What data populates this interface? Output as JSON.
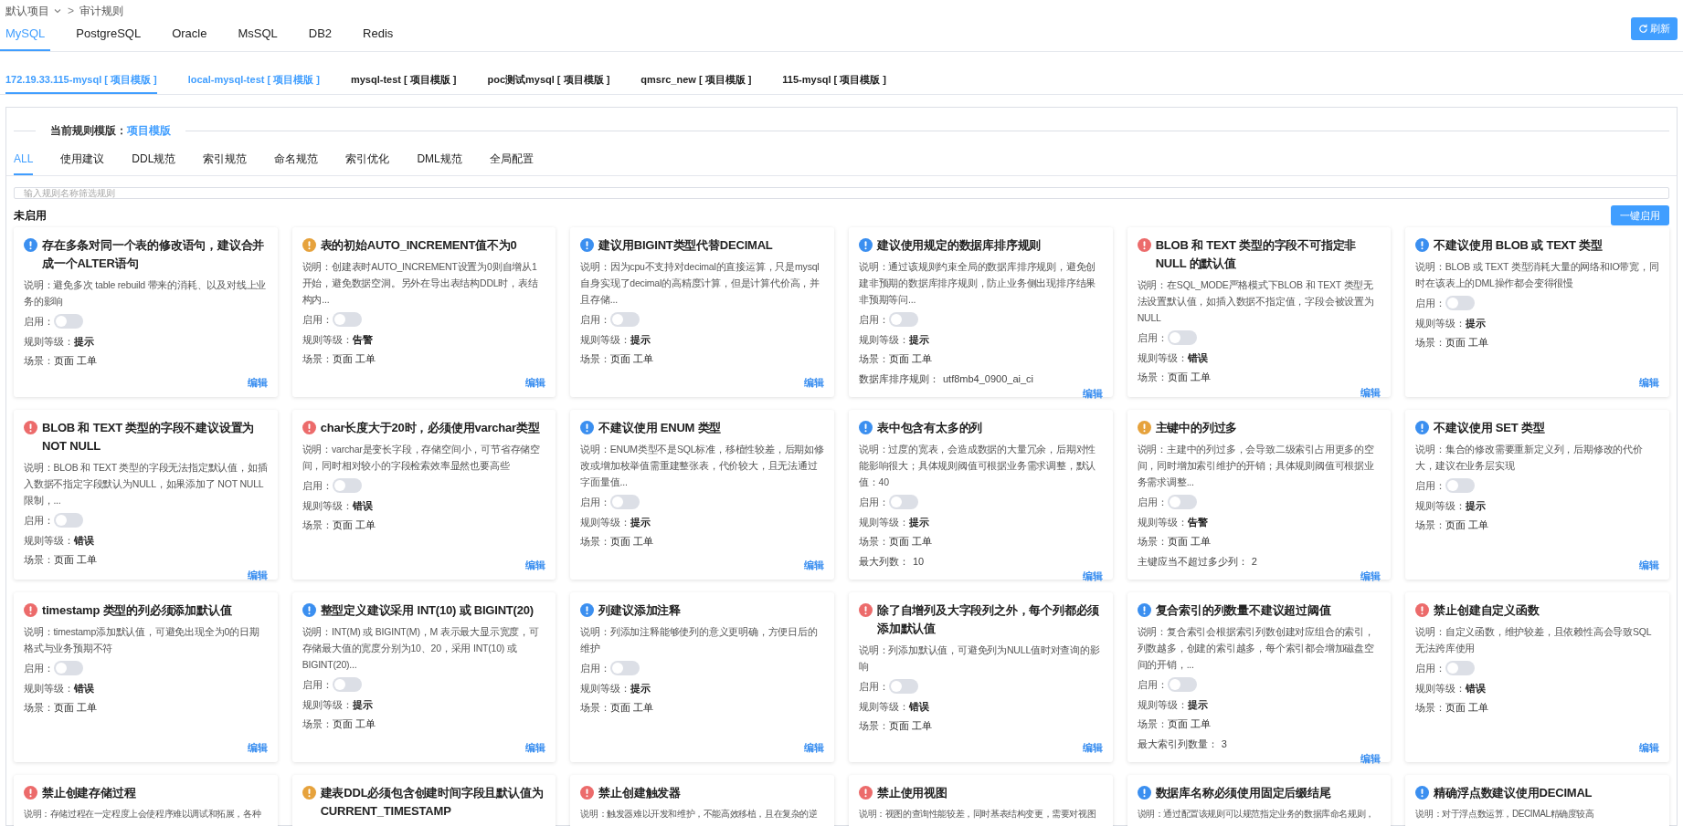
{
  "breadcrumb": {
    "project": "默认项目",
    "separator": ">",
    "page": "审计规则"
  },
  "db_tabs": [
    {
      "label": "MySQL",
      "selected": true
    },
    {
      "label": "PostgreSQL",
      "selected": false
    },
    {
      "label": "Oracle",
      "selected": false
    },
    {
      "label": "MsSQL",
      "selected": false
    },
    {
      "label": "DB2",
      "selected": false
    },
    {
      "label": "Redis",
      "selected": false
    }
  ],
  "refresh_button": "刷新",
  "instance_tabs": [
    {
      "label": "172.19.33.115-mysql [ 项目模版 ]",
      "selected": true,
      "hovered": false
    },
    {
      "label": "local-mysql-test [ 项目模版 ]",
      "selected": false,
      "hovered": true
    },
    {
      "label": "mysql-test [ 项目模版 ]",
      "selected": false,
      "hovered": false
    },
    {
      "label": "poc测试mysql [ 项目模版 ]",
      "selected": false,
      "hovered": false
    },
    {
      "label": "qmsrc_new [ 项目模版 ]",
      "selected": false,
      "hovered": false
    },
    {
      "label": "115-mysql [ 项目模版 ]",
      "selected": false,
      "hovered": false
    }
  ],
  "template": {
    "label": "当前规则模版：",
    "value": "项目模版"
  },
  "category_tabs": [
    {
      "label": "ALL",
      "selected": true
    },
    {
      "label": "使用建议",
      "selected": false
    },
    {
      "label": "DDL规范",
      "selected": false
    },
    {
      "label": "索引规范",
      "selected": false
    },
    {
      "label": "命名规范",
      "selected": false
    },
    {
      "label": "索引优化",
      "selected": false
    },
    {
      "label": "DML规范",
      "selected": false
    },
    {
      "label": "全局配置",
      "selected": false
    }
  ],
  "search": {
    "placeholder": "输入规则名称筛选规则"
  },
  "section": {
    "title": "未启用",
    "button": "一键启用"
  },
  "rules": [
    {
      "color": "#3b8ff0",
      "title": "存在多条对同一个表的修改语句，建议合并成一个ALTER语句",
      "description": "说明：避免多次 table rebuild 带来的消耗、以及对线上业务的影响",
      "enable_label": "启用：",
      "enabled": false,
      "level_label": "规则等级：",
      "level": "提示",
      "scene_label": "场景：",
      "scene": "页面 工单",
      "edit": "编辑"
    },
    {
      "color": "#e6a23c",
      "title": "表的初始AUTO_INCREMENT值不为0",
      "description": "说明：创建表时AUTO_INCREMENT设置为0则自增从1开始，避免数据空洞。另外在导出表结构DDL时，表结构内...",
      "enable_label": "启用：",
      "enabled": false,
      "level_label": "规则等级：",
      "level": "告警",
      "scene_label": "场景：",
      "scene": "页面 工单",
      "edit": "编辑"
    },
    {
      "color": "#3b8ff0",
      "title": "建议用BIGINT类型代替DECIMAL",
      "description": "说明：因为cpu不支持对decimal的直接运算，只是mysql自身实现了decimal的高精度计算，但是计算代价高，并且存储...",
      "enable_label": "启用：",
      "enabled": false,
      "level_label": "规则等级：",
      "level": "提示",
      "scene_label": "场景：",
      "scene": "页面 工单",
      "edit": "编辑"
    },
    {
      "color": "#3b8ff0",
      "title": "建议使用规定的数据库排序规则",
      "description": "说明：通过该规则约束全局的数据库排序规则，避免创建非预期的数据库排序规则，防止业务侧出现排序结果非预期等问...",
      "enable_label": "启用：",
      "enabled": false,
      "level_label": "规则等级：",
      "level": "提示",
      "scene_label": "场景：",
      "scene": "页面 工单",
      "extra": {
        "label": "数据库排序规则：",
        "value": "utf8mb4_0900_ai_ci"
      },
      "edit": "编辑"
    },
    {
      "color": "#ec6b6b",
      "title": "BLOB 和 TEXT 类型的字段不可指定非 NULL 的默认值",
      "description": "说明：在SQL_MODE严格模式下BLOB 和 TEXT 类型无法设置默认值，如插入数据不指定值，字段会被设置为NULL",
      "enable_label": "启用：",
      "enabled": false,
      "level_label": "规则等级：",
      "level": "错误",
      "scene_label": "场景：",
      "scene": "页面 工单",
      "edit": "编辑"
    },
    {
      "color": "#3b8ff0",
      "title": "不建议使用 BLOB 或 TEXT 类型",
      "description": "说明：BLOB 或 TEXT 类型消耗大量的网络和IO带宽，同时在该表上的DML操作都会变得很慢",
      "enable_label": "启用：",
      "enabled": false,
      "level_label": "规则等级：",
      "level": "提示",
      "scene_label": "场景：",
      "scene": "页面 工单",
      "edit": "编辑"
    },
    {
      "color": "#ec6b6b",
      "title": "BLOB 和 TEXT 类型的字段不建议设置为 NOT NULL",
      "description": "说明：BLOB 和 TEXT 类型的字段无法指定默认值，如插入数据不指定字段默认为NULL，如果添加了 NOT NULL 限制，...",
      "enable_label": "启用：",
      "enabled": false,
      "level_label": "规则等级：",
      "level": "错误",
      "scene_label": "场景：",
      "scene": "页面 工单",
      "edit": "编辑"
    },
    {
      "color": "#ec6b6b",
      "title": "char长度大于20时，必须使用varchar类型",
      "description": "说明：varchar是变长字段，存储空间小，可节省存储空间，同时相对较小的字段检索效率显然也要高些",
      "enable_label": "启用：",
      "enabled": false,
      "level_label": "规则等级：",
      "level": "错误",
      "scene_label": "场景：",
      "scene": "页面 工单",
      "edit": "编辑"
    },
    {
      "color": "#3b8ff0",
      "title": "不建议使用 ENUM 类型",
      "description": "说明：ENUM类型不是SQL标准，移植性较差，后期如修改或增加枚举值需重建整张表，代价较大，且无法通过字面量值...",
      "enable_label": "启用：",
      "enabled": false,
      "level_label": "规则等级：",
      "level": "提示",
      "scene_label": "场景：",
      "scene": "页面 工单",
      "edit": "编辑"
    },
    {
      "color": "#3b8ff0",
      "title": "表中包含有太多的列",
      "description": "说明：过度的宽表，会造成数据的大量冗余，后期对性能影响很大；具体规则阈值可根据业务需求调整，默认值：40",
      "enable_label": "启用：",
      "enabled": false,
      "level_label": "规则等级：",
      "level": "提示",
      "scene_label": "场景：",
      "scene": "页面 工单",
      "extra": {
        "label": "最大列数：",
        "value": "10"
      },
      "edit": "编辑"
    },
    {
      "color": "#e6a23c",
      "title": "主键中的列过多",
      "description": "说明：主建中的列过多，会导致二级索引占用更多的空间，同时增加索引维护的开销；具体规则阈值可根据业务需求调整...",
      "enable_label": "启用：",
      "enabled": false,
      "level_label": "规则等级：",
      "level": "告警",
      "scene_label": "场景：",
      "scene": "页面 工单",
      "extra": {
        "label": "主键应当不超过多少列：",
        "value": "2"
      },
      "edit": "编辑"
    },
    {
      "color": "#3b8ff0",
      "title": "不建议使用 SET 类型",
      "description": "说明：集合的修改需要重新定义列，后期修改的代价大，建议在业务层实现",
      "enable_label": "启用：",
      "enabled": false,
      "level_label": "规则等级：",
      "level": "提示",
      "scene_label": "场景：",
      "scene": "页面 工单",
      "edit": "编辑"
    },
    {
      "color": "#ec6b6b",
      "title": "timestamp 类型的列必须添加默认值",
      "description": "说明：timestamp添加默认值，可避免出现全为0的日期格式与业务预期不符",
      "enable_label": "启用：",
      "enabled": false,
      "level_label": "规则等级：",
      "level": "错误",
      "scene_label": "场景：",
      "scene": "页面 工单",
      "edit": "编辑"
    },
    {
      "color": "#3b8ff0",
      "title": "整型定义建议采用 INT(10) 或 BIGINT(20)",
      "description": "说明：INT(M) 或 BIGINT(M)，M 表示最大显示宽度，可存储最大值的宽度分别为10、20，采用 INT(10) 或 BIGINT(20)...",
      "enable_label": "启用：",
      "enabled": false,
      "level_label": "规则等级：",
      "level": "提示",
      "scene_label": "场景：",
      "scene": "页面 工单",
      "edit": "编辑"
    },
    {
      "color": "#3b8ff0",
      "title": "列建议添加注释",
      "description": "说明：列添加注释能够使列的意义更明确，方便日后的维护",
      "enable_label": "启用：",
      "enabled": false,
      "level_label": "规则等级：",
      "level": "提示",
      "scene_label": "场景：",
      "scene": "页面 工单",
      "edit": "编辑"
    },
    {
      "color": "#ec6b6b",
      "title": "除了自增列及大字段列之外，每个列都必须添加默认值",
      "description": "说明：列添加默认值，可避免列为NULL值时对查询的影响",
      "enable_label": "启用：",
      "enabled": false,
      "level_label": "规则等级：",
      "level": "错误",
      "scene_label": "场景：",
      "scene": "页面 工单",
      "edit": "编辑"
    },
    {
      "color": "#3b8ff0",
      "title": "复合索引的列数量不建议超过阈值",
      "description": "说明：复合索引会根据索引列数创建对应组合的索引，列数越多，创建的索引越多，每个索引都会增加磁盘空间的开销，...",
      "enable_label": "启用：",
      "enabled": false,
      "level_label": "规则等级：",
      "level": "提示",
      "scene_label": "场景：",
      "scene": "页面 工单",
      "extra": {
        "label": "最大索引列数量：",
        "value": "3"
      },
      "edit": "编辑"
    },
    {
      "color": "#ec6b6b",
      "title": "禁止创建自定义函数",
      "description": "说明：自定义函数，维护较差，且依赖性高会导致SQL无法跨库使用",
      "enable_label": "启用：",
      "enabled": false,
      "level_label": "规则等级：",
      "level": "错误",
      "scene_label": "场景：",
      "scene": "页面 工单",
      "edit": "编辑"
    },
    {
      "color": "#ec6b6b",
      "title": "禁止创建存储过程",
      "description": "说明：存储过程在一定程度上会使程序难以调试和拓展，各种"
    },
    {
      "color": "#e6a23c",
      "title": "建表DDL必须包含创建时间字段且默认值为CURRENT_TIMESTAMP"
    },
    {
      "color": "#ec6b6b",
      "title": "禁止创建触发器",
      "description": "说明：触发器难以开发和维护，不能高效移植，且在复杂的逆"
    },
    {
      "color": "#ec6b6b",
      "title": "禁止使用视图",
      "description": "说明：视图的查询性能较差，同时基表结构变更，需要对视图"
    },
    {
      "color": "#3b8ff0",
      "title": "数据库名称必须使用固定后缀结尾",
      "description": "说明：通过配置该规则可以规范指定业务的数据库命名规则，"
    },
    {
      "color": "#3b8ff0",
      "title": "精确浮点数建议使用DECIMAL",
      "description": "说明：对于浮点数运算，DECIMAL精确度较高"
    }
  ]
}
